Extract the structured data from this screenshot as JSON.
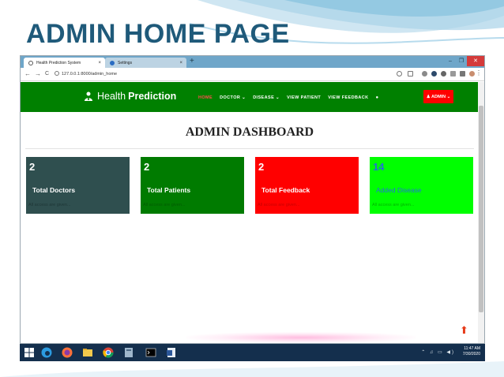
{
  "slide": {
    "title": "ADMIN HOME PAGE"
  },
  "browser": {
    "tabs": [
      {
        "label": "Health Prediction System",
        "close": "×"
      },
      {
        "label": "Settings",
        "close": "×"
      }
    ],
    "new_tab": "+",
    "window_controls": {
      "minimize": "–",
      "maximize": "❐",
      "close": "✕"
    },
    "nav": {
      "back": "←",
      "forward": "→",
      "reload": "C"
    },
    "url": "127.0.0.1:8000/admin_home"
  },
  "site": {
    "brand_regular": "Health",
    "brand_bold": "Prediction",
    "menu": [
      {
        "label": "HOME",
        "active": true
      },
      {
        "label": "DOCTOR ⌄",
        "active": false
      },
      {
        "label": "DISEASE ⌄",
        "active": false
      },
      {
        "label": "VIEW PATIENT",
        "active": false
      },
      {
        "label": "VIEW FEEDBACK",
        "active": false
      }
    ],
    "bell": "🔔",
    "admin_button": "♟ ADMIN ⌄",
    "colors": {
      "nav": "#008000",
      "admin": "#ff0000"
    }
  },
  "dashboard": {
    "title": "ADMIN DASHBOARD",
    "cards": [
      {
        "count": "2",
        "label": "Total Doctors",
        "sub": "All access are given...",
        "color": "#2f4f4f"
      },
      {
        "count": "2",
        "label": "Total Patients",
        "sub": "All access are given...",
        "color": "#007b00"
      },
      {
        "count": "2",
        "label": "Total Feedback",
        "sub": "All access are given...",
        "color": "#ff0000"
      },
      {
        "count": "14",
        "label": "Added Disease",
        "sub": "All access are given...",
        "color": "#00ff00"
      }
    ],
    "scroll_top_icon": "⬆"
  },
  "taskbar": {
    "time": "11:47 AM",
    "date": "7/30/2020",
    "tray": "⌃ ♫ ▭ ◀)",
    "icons": [
      "windows-start-icon",
      "edge-icon",
      "firefox-icon",
      "file-explorer-icon",
      "chrome-icon",
      "app-icon",
      "terminal-icon",
      "word-icon"
    ]
  }
}
